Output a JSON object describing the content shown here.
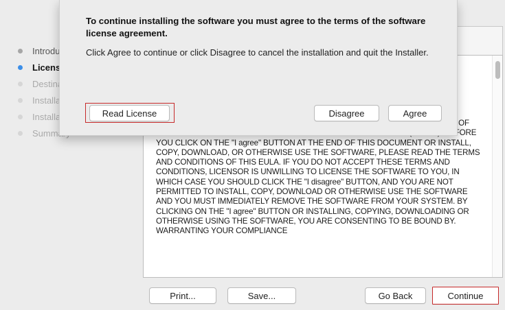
{
  "sidebar": {
    "steps": [
      {
        "label": "Introduction",
        "state": "done"
      },
      {
        "label": "License",
        "state": "current"
      },
      {
        "label": "Destination Select",
        "state": "future"
      },
      {
        "label": "Installation Type",
        "state": "future"
      },
      {
        "label": "Installation",
        "state": "future"
      },
      {
        "label": "Summary",
        "state": "future"
      }
    ]
  },
  "sheet": {
    "title": "To continue installing the software you must agree to the terms of the software license agreement.",
    "message": "Click Agree to continue or click Disagree to cancel the installation and quit the Installer.",
    "read_license_label": "Read License",
    "disagree_label": "Disagree",
    "agree_label": "Agree"
  },
  "license": {
    "text": "THE SOFTWARE (\"YOU\") SOLELY UPON THE CONDITION THAT YOU ACCEPT ALL OF THE TERMS CONTAINED IN THIS END USER LICENSE AGREEMENT (\"EULA\"). BEFORE YOU CLICK ON THE \"I agree\" BUTTON AT THE END OF THIS DOCUMENT OR INSTALL, COPY, DOWNLOAD, OR OTHERWISE USE THE SOFTWARE, PLEASE READ THE TERMS AND CONDITIONS OF THIS EULA. IF YOU DO NOT ACCEPT THESE TERMS AND CONDITIONS, LICENSOR IS UNWILLING TO LICENSE THE SOFTWARE TO YOU, IN WHICH CASE YOU SHOULD CLICK THE \"I disagree\" BUTTON, AND YOU ARE NOT PERMITTED TO INSTALL, COPY, DOWNLOAD OR OTHERWISE USE THE SOFTWARE AND YOU MUST IMMEDIATELY REMOVE THE SOFTWARE FROM YOUR SYSTEM. BY CLICKING ON THE \"I agree\" BUTTON OR INSTALLING, COPYING, DOWNLOADING OR OTHERWISE USING THE SOFTWARE, YOU ARE CONSENTING TO BE BOUND BY. WARRANTING YOUR COMPLIANCE"
  },
  "footer": {
    "print_label": "Print...",
    "save_label": "Save...",
    "go_back_label": "Go Back",
    "continue_label": "Continue"
  },
  "colors": {
    "highlight_border": "#c62828",
    "current_step_dot": "#3b8ee8"
  }
}
